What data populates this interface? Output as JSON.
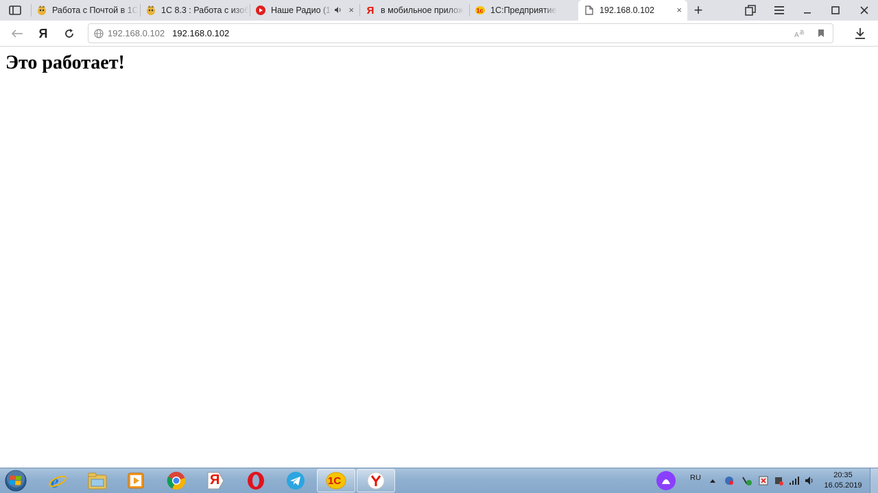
{
  "browser": {
    "tabs": [
      {
        "title": "Работа с Почтой в 1С",
        "icon": "1c-forum-icon",
        "active": false
      },
      {
        "title": "1С 8.3 : Работа с изоб",
        "icon": "1c-forum-icon",
        "active": false
      },
      {
        "title": "Наше Радио (1С",
        "icon": "youtube-icon",
        "active": false,
        "audio": true
      },
      {
        "title": "в мобильное прилож",
        "icon": "yandex-icon",
        "active": false
      },
      {
        "title": "1С:Предприятие",
        "icon": "1c-logo-icon",
        "active": false
      },
      {
        "title": "192.168.0.102",
        "icon": "page-icon",
        "active": true
      }
    ],
    "new_tab_label": "+",
    "close_symbol": "×",
    "address": {
      "site_label": "192.168.0.102",
      "url": "192.168.0.102"
    },
    "yandex_logo": "Я"
  },
  "page": {
    "heading": "Это работает!"
  },
  "taskbar": {
    "apps": [
      "internet-explorer-icon",
      "file-explorer-icon",
      "media-player-icon",
      "chrome-icon",
      "yandex-icon",
      "opera-icon",
      "telegram-icon",
      "1c-logo-icon",
      "yandex-browser-icon"
    ],
    "yandex_label": "Я",
    "onec_label": "1С",
    "language": "RU",
    "time": "20:35",
    "date": "16.05.2019"
  },
  "colors": {
    "tabbar": "#dfe1e6",
    "taskbar": "#90b0d0",
    "youtube_red": "#e02020",
    "yandex_red": "#e61400",
    "onec_yellow": "#f5c400"
  }
}
